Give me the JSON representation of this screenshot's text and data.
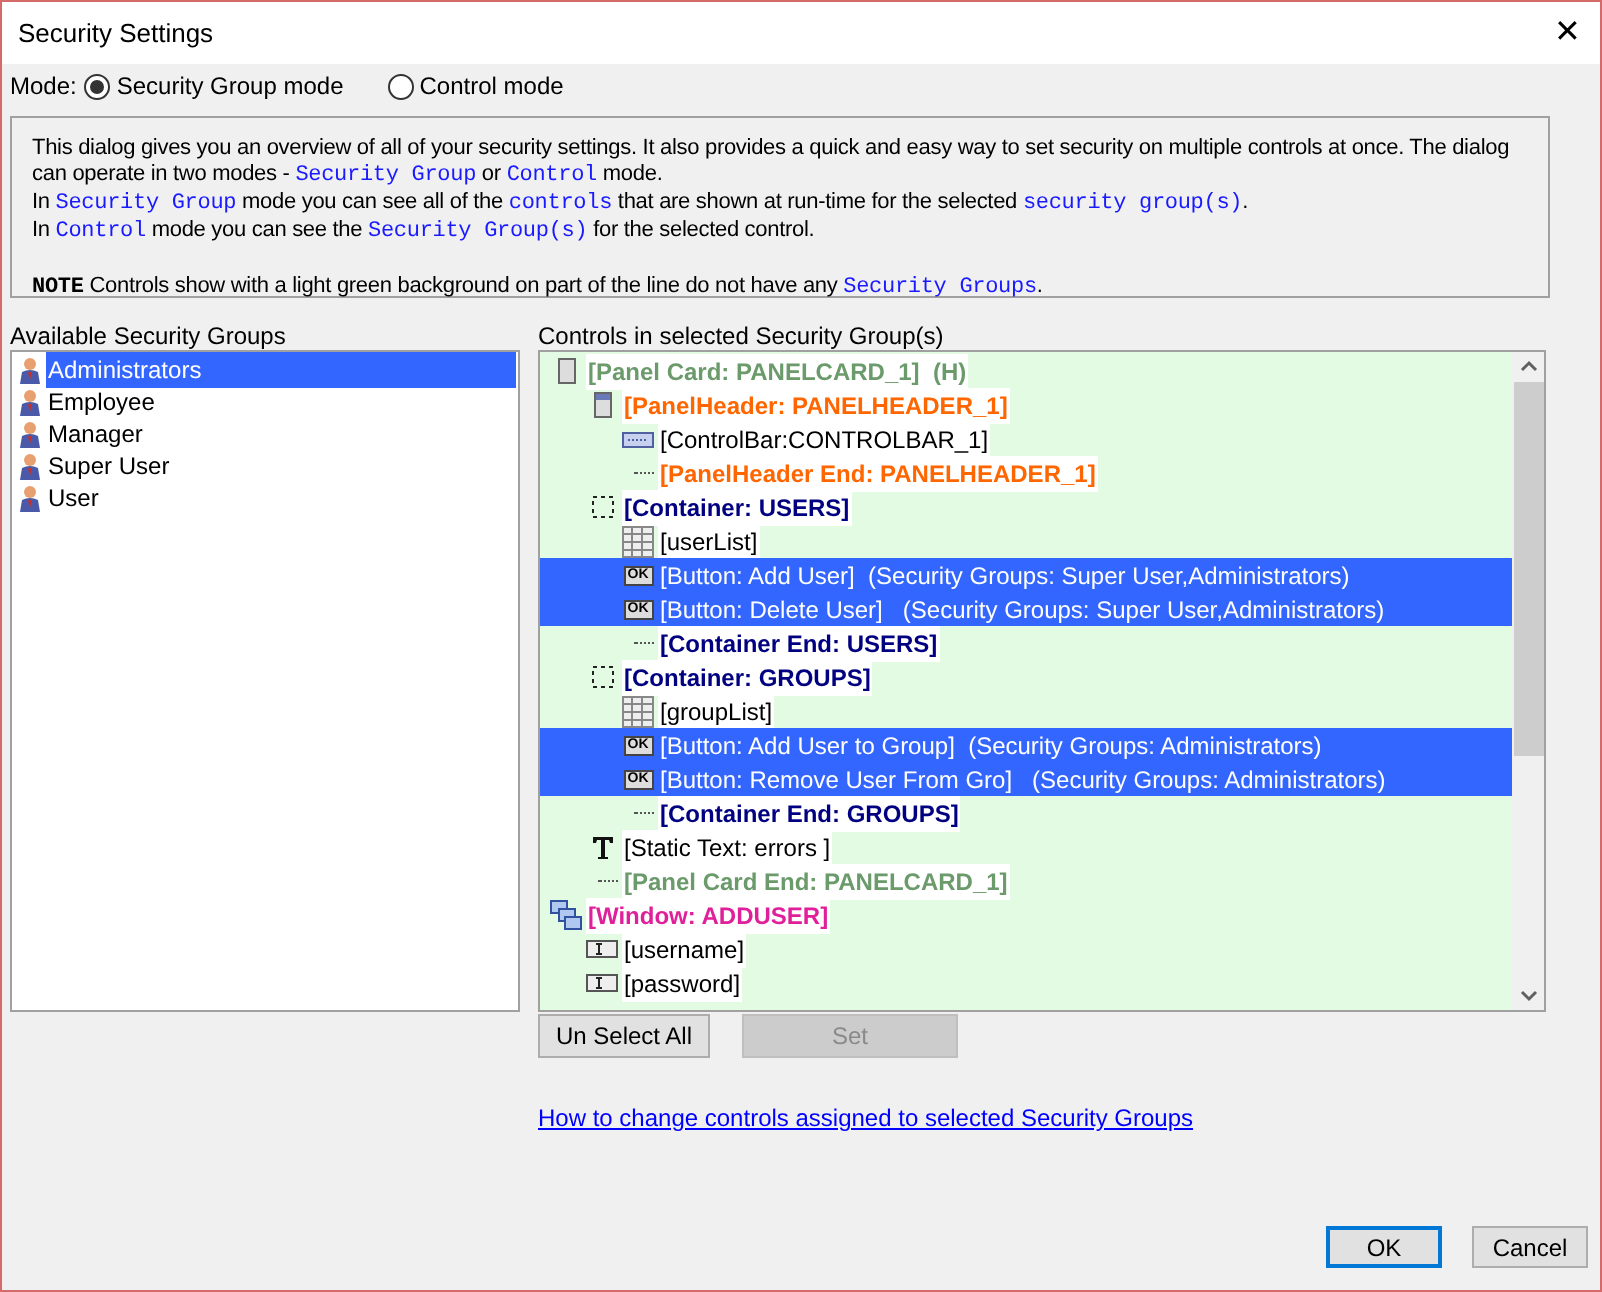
{
  "window": {
    "title": "Security Settings",
    "close": "✕"
  },
  "mode": {
    "label": "Mode:",
    "options": [
      {
        "label": "Security Group mode",
        "selected": true
      },
      {
        "label": "Control mode",
        "selected": false
      }
    ]
  },
  "info": {
    "lines": [
      [
        {
          "kind": "text",
          "text": "This dialog gives you an overview of all of your security settings. It also provides a quick and easy way to set security on multiple controls at once. The dialog can operate in two modes - "
        },
        {
          "kind": "code",
          "text": "Security Group"
        },
        {
          "kind": "text",
          "text": " or "
        },
        {
          "kind": "code",
          "text": "Control"
        },
        {
          "kind": "text",
          "text": " mode."
        }
      ],
      [
        {
          "kind": "text",
          "text": "In "
        },
        {
          "kind": "code",
          "text": "Security Group"
        },
        {
          "kind": "text",
          "text": " mode you can see all of the "
        },
        {
          "kind": "code",
          "text": "controls"
        },
        {
          "kind": "text",
          "text": " that are shown at run-time for the selected "
        },
        {
          "kind": "code",
          "text": "security group(s)"
        },
        {
          "kind": "text",
          "text": "."
        }
      ],
      [
        {
          "kind": "text",
          "text": "In "
        },
        {
          "kind": "code",
          "text": "Control"
        },
        {
          "kind": "text",
          "text": " mode you can see the "
        },
        {
          "kind": "code",
          "text": "Security Group(s)"
        },
        {
          "kind": "text",
          "text": " for the selected control."
        }
      ]
    ],
    "note": [
      {
        "kind": "note",
        "text": "NOTE"
      },
      {
        "kind": "text",
        "text": " Controls show with a light green background on part of the line do not have any "
      },
      {
        "kind": "code",
        "text": "Security Groups"
      },
      {
        "kind": "text",
        "text": "."
      }
    ]
  },
  "groups": {
    "label": "Available Security Groups",
    "items": [
      {
        "label": "Administrators",
        "selected": true
      },
      {
        "label": "Employee",
        "selected": false
      },
      {
        "label": "Manager",
        "selected": false
      },
      {
        "label": "Super User",
        "selected": false
      },
      {
        "label": "User",
        "selected": false
      }
    ]
  },
  "controls": {
    "label": "Controls in selected Security Group(s)",
    "tree": [
      {
        "kind": "panel",
        "text": "[Panel Card: PANELCARD_1]  (H)",
        "selected": false,
        "children": [
          {
            "kind": "panel-header",
            "text": "[PanelHeader: PANELHEADER_1]",
            "selected": false,
            "children": [
              {
                "kind": "control-bar",
                "text": "[ControlBar:CONTROLBAR_1]",
                "selected": false
              },
              {
                "kind": "panel-header-end",
                "text": "[PanelHeader End: PANELHEADER_1]",
                "selected": false
              }
            ]
          },
          {
            "kind": "container",
            "text": "[Container: USERS]",
            "selected": false,
            "children": [
              {
                "kind": "list",
                "text": "[userList]",
                "selected": false
              },
              {
                "kind": "button",
                "badge": "OK",
                "text": "[Button: Add User]  (Security Groups: Super User,Administrators)",
                "selected": true
              },
              {
                "kind": "button",
                "badge": "OK",
                "text": "[Button: Delete User]   (Security Groups: Super User,Administrators)",
                "selected": true
              },
              {
                "kind": "container-end",
                "text": "[Container End: USERS]",
                "selected": false
              }
            ]
          },
          {
            "kind": "container",
            "text": "[Container: GROUPS]",
            "selected": false,
            "children": [
              {
                "kind": "list",
                "text": "[groupList]",
                "selected": false
              },
              {
                "kind": "button",
                "badge": "OK",
                "text": "[Button: Add User to Group]  (Security Groups: Administrators)",
                "selected": true
              },
              {
                "kind": "button",
                "badge": "OK",
                "text": "[Button: Remove User From Gro]   (Security Groups: Administrators)",
                "selected": true
              },
              {
                "kind": "container-end",
                "text": "[Container End: GROUPS]",
                "selected": false
              }
            ]
          },
          {
            "kind": "static-text",
            "text": "[Static Text: errors ]",
            "selected": false
          },
          {
            "kind": "panel-end",
            "text": "[Panel Card End: PANELCARD_1]",
            "selected": false
          }
        ]
      },
      {
        "kind": "window",
        "text": "[Window: ADDUSER]",
        "selected": false,
        "children": [
          {
            "kind": "edit",
            "text": "[username]",
            "selected": false
          },
          {
            "kind": "edit",
            "text": "[password]",
            "selected": false
          }
        ]
      }
    ]
  },
  "buttons": [
    {
      "label": "Un Select All",
      "disabled": false
    },
    {
      "label": "Set",
      "disabled": true
    }
  ],
  "link": "How to change controls assigned to selected Security Groups",
  "footer": [
    {
      "label": "OK",
      "default": true
    },
    {
      "label": "Cancel",
      "default": false
    }
  ]
}
